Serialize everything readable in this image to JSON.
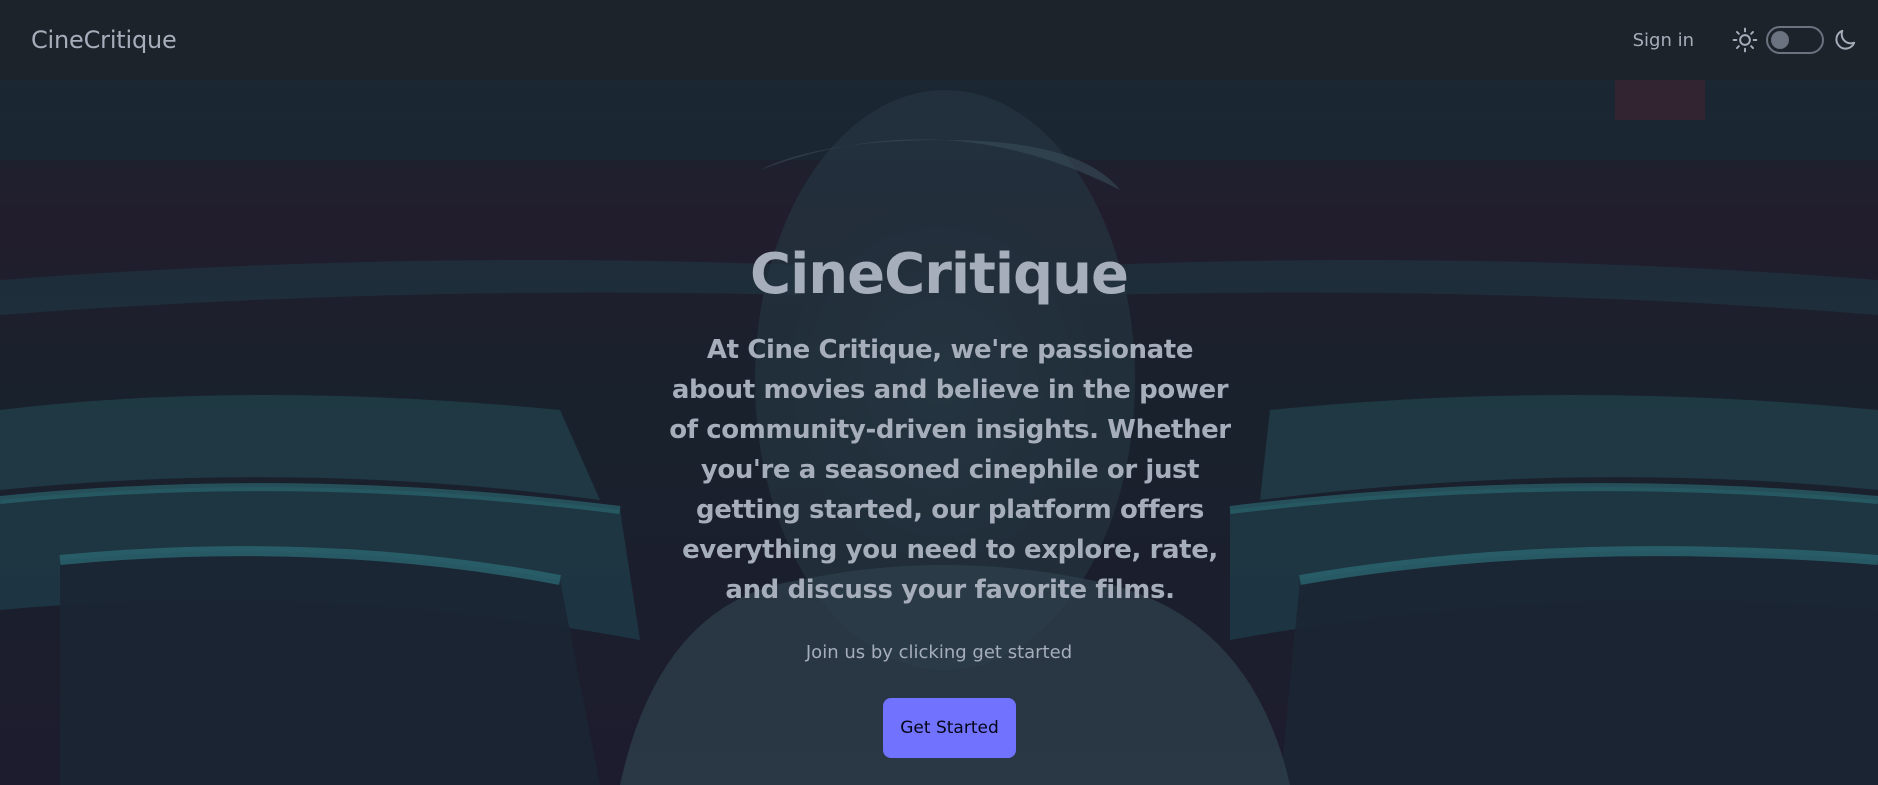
{
  "navbar": {
    "brand": "CineCritique",
    "sign_in_label": "Sign in",
    "theme_icons": [
      "sun-icon",
      "moon-icon"
    ],
    "theme_dark_enabled": false
  },
  "hero": {
    "title": "CineCritique",
    "description": "At Cine Critique, we're passionate about movies and believe in the power of community-driven insights. Whether you're a seasoned cinephile or just getting started, our platform offers everything you need to explore, rate, and discuss your favorite films.",
    "subtitle": "Join us by clicking get started",
    "cta_label": "Get Started"
  },
  "colors": {
    "navbar_bg": "#1d232a",
    "text": "#a6adbb",
    "primary": "#7173ff"
  }
}
